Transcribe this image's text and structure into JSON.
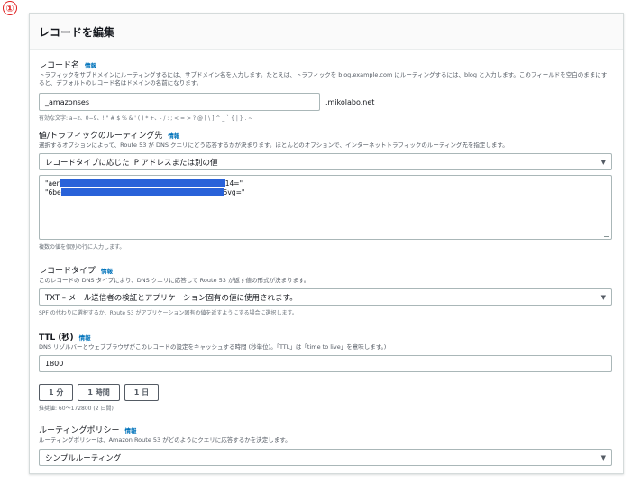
{
  "step_badge": "①",
  "panel": {
    "title": "レコードを編集"
  },
  "record_name": {
    "label": "レコード名",
    "info": "情報",
    "description": "トラフィックをサブドメインにルーティングするには、サブドメイン名を入力します。たとえば、トラフィックを blog.example.com にルーティングするには、blog と入力します。このフィールドを空白のままにすると、デフォルトのレコード名はドメインの名前になります。",
    "value": "_amazonses",
    "domain_suffix": ".mikolabo.net",
    "valid_chars": "有効な文字: a−z、0−9、! \" # $ % & ' ( ) * +、- / : ; < = > ? @ [ \\ ] ^ _ ` { | } . ~"
  },
  "value_field": {
    "label": "値/トラフィックのルーティング先",
    "info": "情報",
    "description": "選択するオプションによって、Route 53 が DNS クエリにどう応答するかが決まります。ほとんどのオプションで、インターネットトラフィックのルーティング先を指定します。",
    "select_value": "レコードタイプに応じた IP アドレスまたは別の値",
    "line1_prefix": "\"aer",
    "line1_suffix": "14=\"",
    "line2_prefix": "\"6be",
    "line2_suffix": "5vg=\"",
    "hint": "複数の値を個別の行に入力します。"
  },
  "record_type": {
    "label": "レコードタイプ",
    "info": "情報",
    "description": "このレコードの DNS タイプにより、DNS クエリに応答して Route 53 が返す値の形式が決まります。",
    "select_value": "TXT – メール送信者の検証とアプリケーション固有の値に使用されます。",
    "hint": "SPF の代わりに選択するか、Route 53 がアプリケーション固有の値を返すようにする場合に選択します。"
  },
  "ttl": {
    "label": "TTL (秒)",
    "info": "情報",
    "description": "DNS リゾルバーとウェブブラウザがこのレコードの設定をキャッシュする時間 (秒単位)。「TTL」は「time to live」を意味します。)",
    "value": "1800",
    "buttons": [
      "1 分",
      "1 時間",
      "1 日"
    ],
    "hint": "推奨値: 60〜172800 (2 日間)"
  },
  "routing_policy": {
    "label": "ルーティングポリシー",
    "info": "情報",
    "description": "ルーティングポリシーは、Amazon Route 53 がどのようにクエリに応答するかを決定します。",
    "select_value": "シンプルルーティング"
  },
  "colors": {
    "link": "#0073bb",
    "redaction": "#2962d9",
    "badge": "#e02020"
  }
}
